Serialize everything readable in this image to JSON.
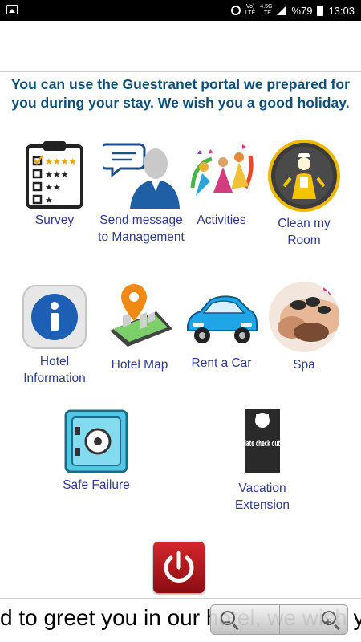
{
  "status_bar": {
    "network_top": "Vo)",
    "network_bottom": "LTE",
    "data_top": "4.5G",
    "data_bottom": "LTE",
    "battery": "%79",
    "time": "13:03"
  },
  "welcome_text": "You can use the Guestranet portal we prepared for you during your stay. We wish you a good holiday.",
  "tiles": {
    "survey": "Survey",
    "send_message": "Send message to Management",
    "activities": "Activities",
    "clean_room": "Clean my Room",
    "hotel_information": "Hotel Information",
    "hotel_map": "Hotel Map",
    "rent_a_car": "Rent a Car",
    "spa": "Spa",
    "safe_failure": "Safe Failure",
    "vacation_extension": "Vacation Extension"
  },
  "door_hanger_text": "late check out",
  "marquee_text": "d to greet you in our hotel, we wish you a lovely",
  "zoom": {
    "minus": "−",
    "plus": "+"
  },
  "icons": {
    "survey": "checklist-icon",
    "send_message": "person-speech-bubble-icon",
    "activities": "dancing-people-icon",
    "clean_room": "housekeeper-icon",
    "hotel_information": "info-icon",
    "hotel_map": "map-pin-icon",
    "rent_a_car": "car-icon",
    "spa": "spa-stones-icon",
    "safe_failure": "safe-icon",
    "vacation_extension": "door-hanger-icon",
    "power": "power-icon"
  }
}
